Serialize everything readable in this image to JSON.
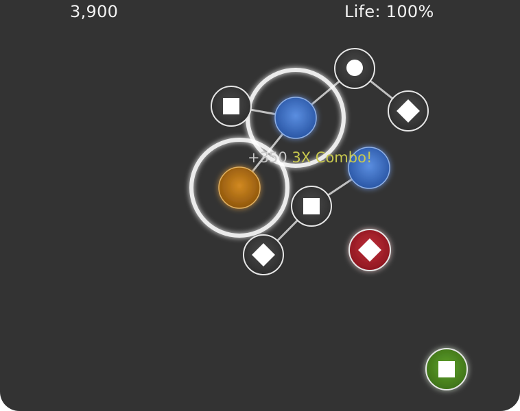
{
  "hud": {
    "score": "3,900",
    "life_label": "Life:",
    "life_value": "100%"
  },
  "popup": {
    "points": "+350",
    "combo": "3X Combo!"
  },
  "colors": {
    "background": "#333333",
    "node_blue": "#2f63b8",
    "node_orange": "#b36e12",
    "node_red": "#b3202a",
    "node_green": "#4a8a1f",
    "ring": "#ffffff"
  },
  "nodes": [
    {
      "id": "n1",
      "shape": "circle",
      "color": "gray"
    },
    {
      "id": "n2",
      "shape": "square",
      "color": "gray"
    },
    {
      "id": "n3",
      "shape": "none",
      "color": "blue"
    },
    {
      "id": "n4",
      "shape": "diamond",
      "color": "gray"
    },
    {
      "id": "n5",
      "shape": "none",
      "color": "orange"
    },
    {
      "id": "n6",
      "shape": "none",
      "color": "blue"
    },
    {
      "id": "n7",
      "shape": "square",
      "color": "gray"
    },
    {
      "id": "n8",
      "shape": "diamond",
      "color": "gray"
    },
    {
      "id": "n9",
      "shape": "diamond",
      "color": "red"
    },
    {
      "id": "n10",
      "shape": "square",
      "color": "green"
    }
  ]
}
